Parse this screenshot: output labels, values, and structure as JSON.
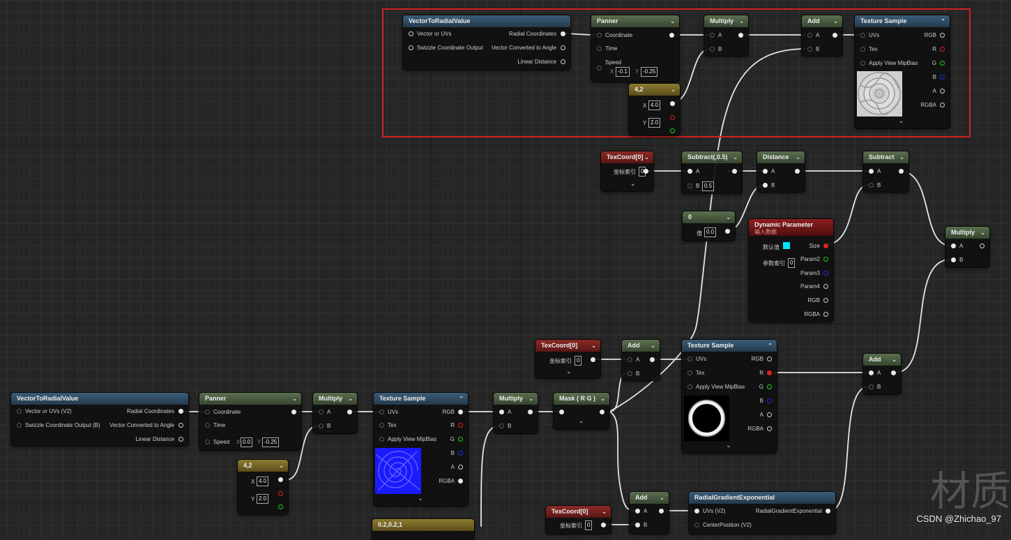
{
  "nodes": {
    "vtr1": {
      "title": "VectorToRadialValue",
      "in1": "Vector or UVs",
      "in2": "Swizzle Coordinate Output",
      "out1": "Radial Coordinates",
      "out2": "Vector Converted to Angle",
      "out3": "Linear Distance"
    },
    "pan1": {
      "title": "Panner",
      "p1": "Coordinate",
      "p2": "Time",
      "p3": "Speed",
      "x": "X",
      "xv": "-0.1",
      "y": "Y",
      "yv": "-0.25"
    },
    "mul1": {
      "title": "Multiply",
      "a": "A",
      "b": "B"
    },
    "add1": {
      "title": "Add",
      "a": "A",
      "b": "B"
    },
    "ts1": {
      "title": "Texture Sample",
      "uvs": "UVs",
      "tex": "Tex",
      "mip": "Apply View MipBias",
      "rgb": "RGB",
      "r": "R",
      "g": "G",
      "b": "B",
      "a": "A",
      "rgba": "RGBA"
    },
    "c42a": {
      "title": "4,2",
      "x": "X",
      "xv": "4.0",
      "y": "Y",
      "yv": "2.0"
    },
    "tc1": {
      "title": "TexCoord[0]",
      "label": "坐标索引",
      "value": "0"
    },
    "sub1": {
      "title": "Subtract(,0.5)",
      "a": "A",
      "b": "B",
      "bv": "0.5"
    },
    "dist": {
      "title": "Distance",
      "a": "A",
      "b": "B"
    },
    "sub2": {
      "title": "Subtract",
      "a": "A",
      "b": "B"
    },
    "zero": {
      "title": "0",
      "label": "值",
      "value": "0.0"
    },
    "dyn": {
      "title": "Dynamic Parameter",
      "subtitle": "输入数据",
      "def": "默认值",
      "idx": "参数索引",
      "idxv": "0",
      "size": "Size",
      "p2": "Param2",
      "p3": "Param3",
      "p4": "Param4",
      "rgb": "RGB",
      "rgba": "RGBA"
    },
    "mul2": {
      "title": "Multiply",
      "a": "A",
      "b": "B"
    },
    "tc2": {
      "title": "TexCoord[0]",
      "label": "坐标索引",
      "value": "0"
    },
    "add2": {
      "title": "Add",
      "a": "A",
      "b": "B"
    },
    "ts2": {
      "title": "Texture Sample",
      "uvs": "UVs",
      "tex": "Tex",
      "mip": "Apply View MipBias",
      "rgb": "RGB",
      "r": "R",
      "g": "G",
      "b": "B",
      "a": "A",
      "rgba": "RGBA"
    },
    "add3": {
      "title": "Add",
      "a": "A",
      "b": "B"
    },
    "vtr2": {
      "title": "VectorToRadialValue",
      "in1": "Vector or UVs (V2)",
      "in2": "Swizzle Coordinate Output (B)",
      "out1": "Radial Coordinates",
      "out2": "Vector Converted to Angle",
      "out3": "Linear Distance"
    },
    "pan2": {
      "title": "Panner",
      "p1": "Coordinate",
      "p2": "Time",
      "p3": "Speed",
      "x": "X",
      "xv": "0.0",
      "y": "Y",
      "yv": "-0.25"
    },
    "mul3": {
      "title": "Multiply",
      "a": "A",
      "b": "B"
    },
    "ts3": {
      "title": "Texture Sample",
      "uvs": "UVs",
      "tex": "Tex",
      "mip": "Apply View MipBias",
      "rgb": "RGB",
      "r": "R",
      "g": "G",
      "b": "B",
      "a": "A",
      "rgba": "RGBA"
    },
    "mul4": {
      "title": "Multiply",
      "a": "A",
      "b": "B"
    },
    "mask": {
      "title": "Mask ( R G )"
    },
    "c42b": {
      "title": "4,2",
      "x": "X",
      "xv": "4.0",
      "y": "Y",
      "yv": "2.0"
    },
    "add4": {
      "title": "Add",
      "a": "A",
      "b": "B"
    },
    "rge": {
      "title": "RadialGradientExponential",
      "in1": "UVs (V2)",
      "in2": "CenterPosition (V2)",
      "out": "RadialGradientExponential"
    },
    "tc3": {
      "title": "TexCoord[0]",
      "label": "坐标索引",
      "value": "0"
    },
    "cpart": {
      "title": "0.2,0.2,1"
    }
  },
  "colors": {
    "selection": "#d42020",
    "param_swatch": "#00e5ff",
    "wire": "#e6e6e6"
  },
  "watermark": {
    "text": "CSDN @Zhichao_97",
    "glyph": "材质"
  }
}
